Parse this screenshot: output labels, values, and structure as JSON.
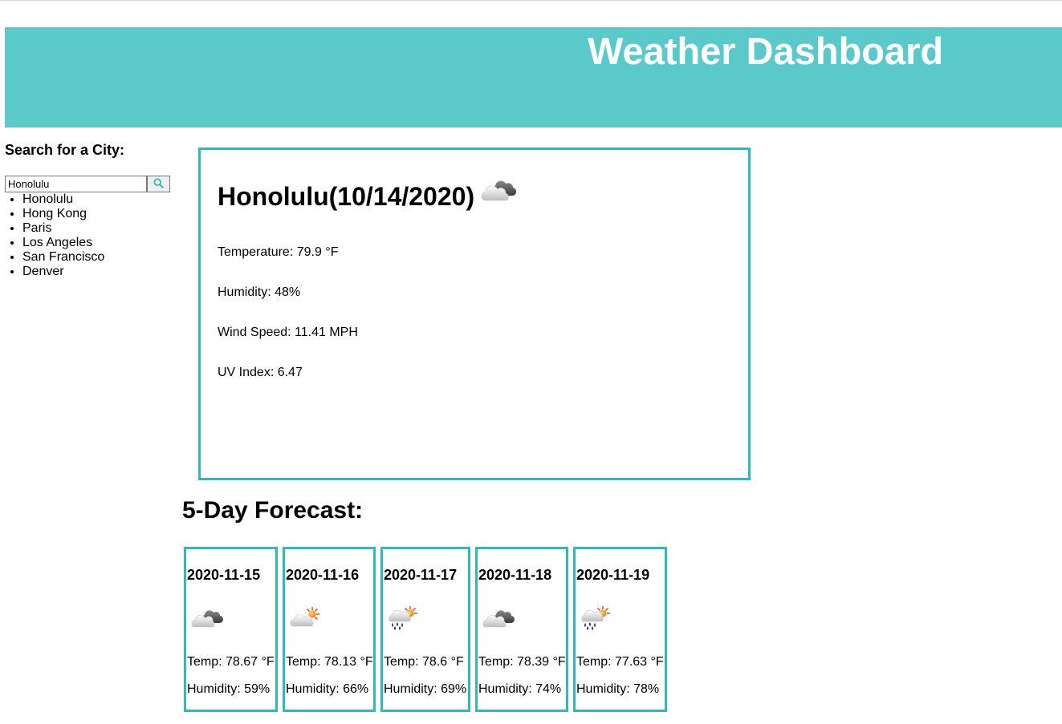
{
  "header": {
    "title": "Weather Dashboard"
  },
  "sidebar": {
    "search_title": "Search for a City:",
    "search_value": "Honolulu",
    "search_icon": "search-icon",
    "cities": [
      "Honolulu",
      "Hong Kong",
      "Paris",
      "Los Angeles",
      "San Francisco",
      "Denver"
    ]
  },
  "current": {
    "title": "Honolulu(10/14/2020)",
    "icon": "cloudy-icon",
    "temperature": "Temperature: 79.9 °F",
    "humidity": "Humidity: 48%",
    "wind": "Wind Speed: 11.41 MPH",
    "uv": "UV Index: 6.47"
  },
  "forecast": {
    "title": "5-Day Forecast:",
    "days": [
      {
        "date": "2020-11-15",
        "icon": "cloudy-icon",
        "temp": "Temp: 78.67 °F",
        "humidity": "Humidity: 59%"
      },
      {
        "date": "2020-11-16",
        "icon": "partly-sunny-icon",
        "temp": "Temp: 78.13 °F",
        "humidity": "Humidity: 66%"
      },
      {
        "date": "2020-11-17",
        "icon": "sun-rain-icon",
        "temp": "Temp: 78.6 °F",
        "humidity": "Humidity: 69%"
      },
      {
        "date": "2020-11-18",
        "icon": "cloudy-icon",
        "temp": "Temp: 78.39 °F",
        "humidity": "Humidity: 74%"
      },
      {
        "date": "2020-11-19",
        "icon": "sun-rain-icon",
        "temp": "Temp: 77.63 °F",
        "humidity": "Humidity: 78%"
      }
    ]
  },
  "colors": {
    "header": "#5bc8ca",
    "border": "#2bbbbd"
  }
}
